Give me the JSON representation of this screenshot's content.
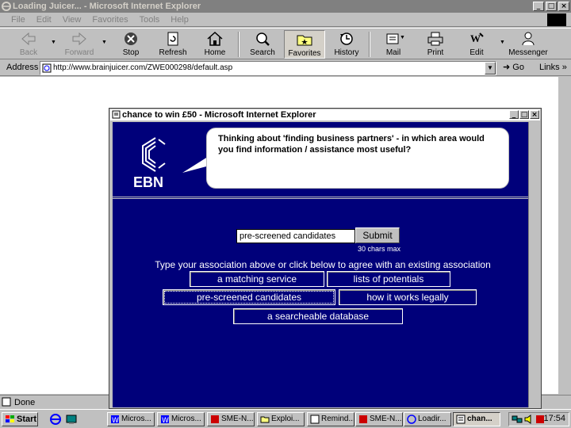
{
  "main_window": {
    "title": "Loading Juicer... - Microsoft Internet Explorer",
    "menu": [
      "File",
      "Edit",
      "View",
      "Favorites",
      "Tools",
      "Help"
    ],
    "toolbar": [
      {
        "label": "Back",
        "icon": "back-arrow-icon"
      },
      {
        "label": "Forward",
        "icon": "forward-arrow-icon"
      },
      {
        "label": "Stop",
        "icon": "stop-icon"
      },
      {
        "label": "Refresh",
        "icon": "refresh-icon"
      },
      {
        "label": "Home",
        "icon": "home-icon"
      },
      {
        "label": "Search",
        "icon": "search-icon"
      },
      {
        "label": "Favorites",
        "icon": "favorites-folder-icon"
      },
      {
        "label": "History",
        "icon": "history-icon"
      },
      {
        "label": "Mail",
        "icon": "mail-icon"
      },
      {
        "label": "Print",
        "icon": "print-icon"
      },
      {
        "label": "Edit",
        "icon": "edit-icon"
      },
      {
        "label": "Messenger",
        "icon": "messenger-icon"
      }
    ],
    "address_label": "Address",
    "address_url": "http://www.brainjuicer.com/ZWE000298/default.asp",
    "go_label": "Go",
    "links_label": "Links",
    "status": "Done"
  },
  "popup": {
    "title": "chance to win £50 - Microsoft Internet Explorer",
    "logo_text": "EBN",
    "question": "Thinking about 'finding business partners' - in which area would you find information / assistance most useful?",
    "input_value": "pre-screened candidates",
    "submit_label": "Submit",
    "max_note": "30 chars max",
    "instructions": "Type your association above or click below to agree with an existing association",
    "associations": [
      "a matching service",
      "lists of potentials",
      "pre-screened candidates",
      "how it works legally",
      "a searcheable database"
    ],
    "selected_association": "pre-screened candidates"
  },
  "taskbar": {
    "start_label": "Start",
    "tasks": [
      "Micros...",
      "Micros...",
      "SME-N...",
      "Exploi...",
      "Remind...",
      "SME-N...",
      "Loadir...",
      "chan..."
    ],
    "active_task": "chan...",
    "clock": "17:54"
  },
  "colors": {
    "popup_background": "#00007a",
    "window_chrome": "#c0c0c0",
    "inactive_title": "#808080"
  }
}
